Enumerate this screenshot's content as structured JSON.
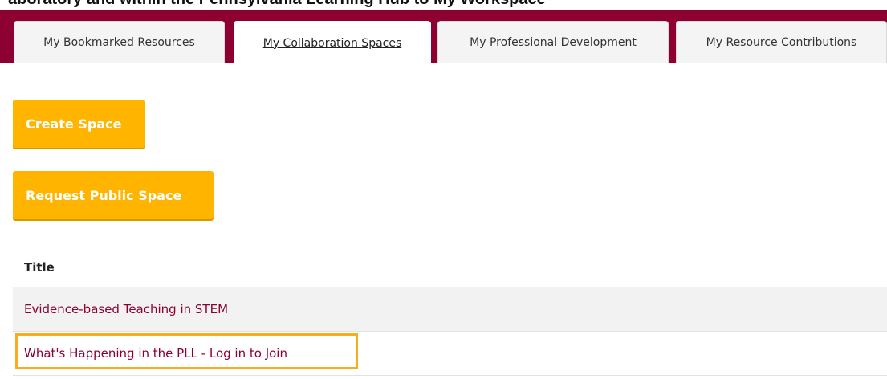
{
  "header": {
    "cropped_heading": "aboratory and within the Pennsylvania Learning Hub to My Workspace"
  },
  "tabs": [
    {
      "label": "My Bookmarked Resources",
      "active": false
    },
    {
      "label": "My Collaboration Spaces",
      "active": true
    },
    {
      "label": "My Professional Development",
      "active": false
    },
    {
      "label": "My Resource Contributions",
      "active": false
    }
  ],
  "actions": {
    "create_space_label": "Create Space",
    "request_public_space_label": "Request Public Space"
  },
  "table": {
    "header_title": "Title",
    "rows": [
      {
        "title": "Evidence-based Teaching in STEM"
      },
      {
        "title": "What's Happening in the PLL - Log in to Join"
      }
    ]
  },
  "colors": {
    "brand": "#8c0032",
    "button": "#ffb400",
    "highlight": "#f7ad1e"
  }
}
